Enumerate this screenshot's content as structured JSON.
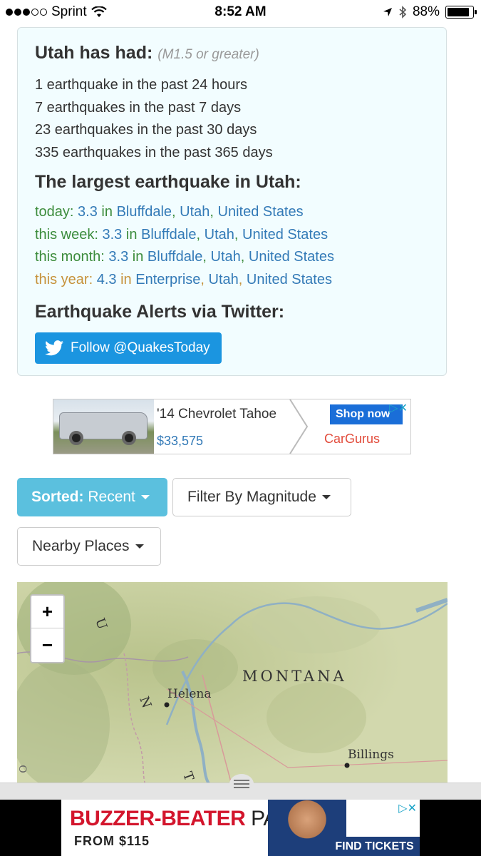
{
  "status_bar": {
    "carrier": "Sprint",
    "time": "8:52 AM",
    "battery": "88%",
    "battery_level": 0.88
  },
  "summary": {
    "title": "Utah has had:",
    "subtitle": "(M1.5 or greater)",
    "counts": [
      "1 earthquake in the past 24 hours",
      "7 earthquakes in the past 7 days",
      "23 earthquakes in the past 30 days",
      "335 earthquakes in the past 365 days"
    ]
  },
  "largest": {
    "title": "The largest earthquake in Utah:",
    "rows": [
      {
        "period": "today:",
        "mag": "3.3",
        "in": "in",
        "city": "Bluffdale",
        "state": "Utah",
        "country": "United States"
      },
      {
        "period": "this week:",
        "mag": "3.3",
        "in": "in",
        "city": "Bluffdale",
        "state": "Utah",
        "country": "United States"
      },
      {
        "period": "this month:",
        "mag": "3.3",
        "in": "in",
        "city": "Bluffdale",
        "state": "Utah",
        "country": "United States"
      },
      {
        "period": "this year:",
        "mag": "4.3",
        "in": "in",
        "city": "Enterprise",
        "state": "Utah",
        "country": "United States"
      }
    ]
  },
  "alerts": {
    "title": "Earthquake Alerts via Twitter:",
    "button_label": "Follow @QuakesToday"
  },
  "ad_top": {
    "headline": "'14 Chevrolet Tahoe",
    "price": "$33,575",
    "cta": "Shop now",
    "brand": "CarGurus"
  },
  "controls": {
    "sorted_label": "Sorted:",
    "sorted_value": "Recent",
    "filter_label": "Filter By Magnitude",
    "nearby_label": "Nearby Places"
  },
  "map": {
    "zoom_in": "+",
    "zoom_out": "−",
    "labels": {
      "state": "MONTANA",
      "city1": "Helena",
      "city2": "Billings",
      "side1": "U",
      "side2": "N",
      "side3": "T",
      "side4": "O"
    }
  },
  "ad_bottom": {
    "headline": "BUZZER-BEATER",
    "headline2": "PACK",
    "price": "FROM $115",
    "cta": "FIND TICKETS"
  },
  "colors": {
    "twitter": "#1b95e0",
    "sort_button": "#5bc0de",
    "link_blue": "#337ab7",
    "green": "#3c8c3c",
    "amber": "#c6923b"
  }
}
